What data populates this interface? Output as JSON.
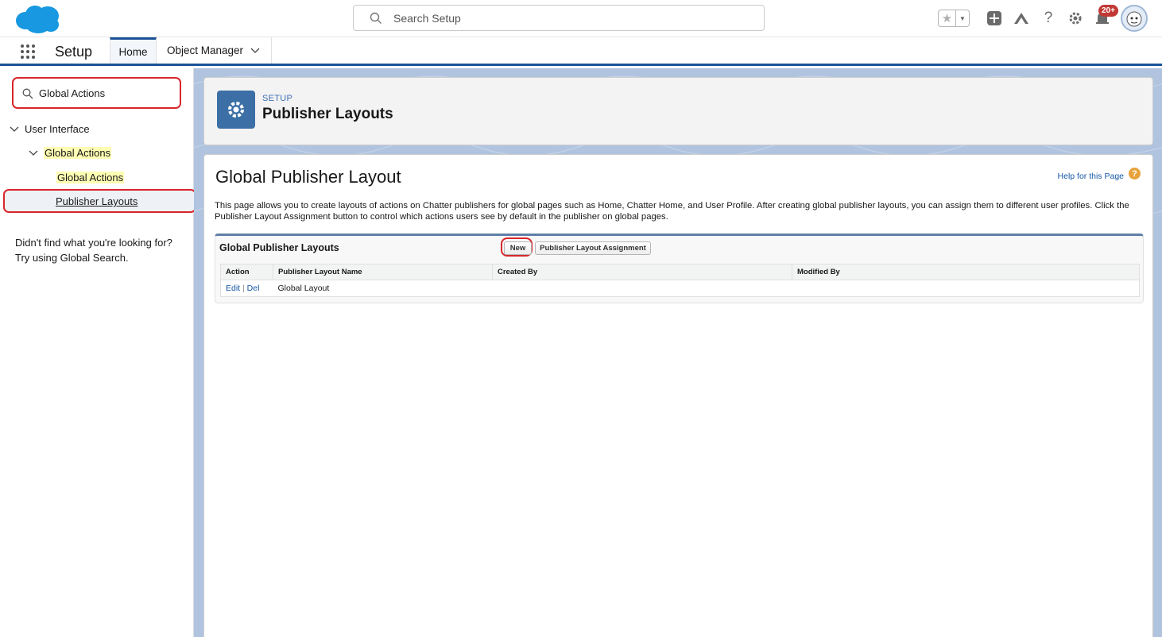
{
  "header": {
    "search_placeholder": "Search Setup",
    "notification_count": "20+",
    "icons": [
      "salesforce-logo",
      "star-icon",
      "chevron-down-icon",
      "plus-icon",
      "trailhead-icon",
      "help-icon",
      "gear-icon",
      "bell-icon",
      "avatar"
    ]
  },
  "nav": {
    "app_name": "Setup",
    "tabs": [
      {
        "label": "Home",
        "active": true
      },
      {
        "label": "Object Manager",
        "has_dropdown": true
      }
    ]
  },
  "sidebar": {
    "quick_find_value": "Global Actions",
    "tree": {
      "user_interface": "User Interface",
      "global_actions_group": "Global Actions",
      "global_actions_item": "Global Actions",
      "publisher_layouts_item": "Publisher Layouts"
    },
    "not_found_line1": "Didn't find what you're looking for?",
    "not_found_line2": "Try using Global Search."
  },
  "page_header": {
    "eyebrow": "SETUP",
    "title": "Publisher Layouts"
  },
  "content": {
    "title": "Global Publisher Layout",
    "help_link": "Help for this Page",
    "description": "This page allows you to create layouts of actions on Chatter publishers for global pages such as Home, Chatter Home, and User Profile. After creating global publisher layouts, you can assign them to different user profiles. Click the Publisher Layout Assignment button to control which actions users see by default in the publisher on global pages.",
    "block_title": "Global Publisher Layouts",
    "new_button": "New",
    "assignment_button": "Publisher Layout Assignment",
    "columns": {
      "action": "Action",
      "name": "Publisher Layout Name",
      "created_by": "Created By",
      "modified_by": "Modified By"
    },
    "rows": [
      {
        "edit": "Edit",
        "sep": "|",
        "del": "Del",
        "name": "Global Layout",
        "created_by": "",
        "modified_by": ""
      }
    ]
  },
  "colors": {
    "brand_blue": "#1b5297",
    "highlight_red": "#d9262b",
    "link_blue": "#1658a6",
    "search_highlight": "#fdfdb3"
  }
}
